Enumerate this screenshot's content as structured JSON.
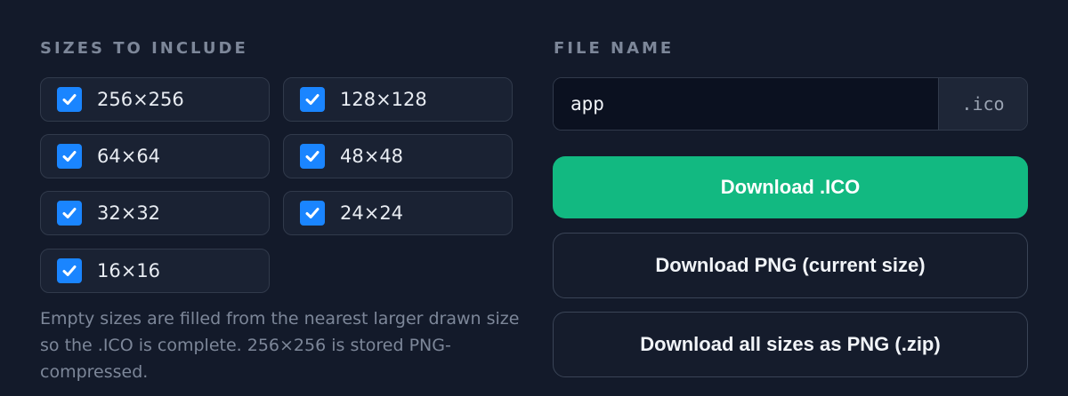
{
  "sizes_section": {
    "title": "SIZES TO INCLUDE",
    "sizes": [
      {
        "label": "256×256",
        "checked": true
      },
      {
        "label": "128×128",
        "checked": true
      },
      {
        "label": "64×64",
        "checked": true
      },
      {
        "label": "48×48",
        "checked": true
      },
      {
        "label": "32×32",
        "checked": true
      },
      {
        "label": "24×24",
        "checked": true
      },
      {
        "label": "16×16",
        "checked": true
      }
    ],
    "note": "Empty sizes are filled from the nearest larger drawn size so the .ICO is complete. 256×256 is stored PNG-compressed."
  },
  "file_section": {
    "title": "FILE NAME",
    "filename_value": "app",
    "extension": ".ico"
  },
  "actions": {
    "download_ico": "Download .ICO",
    "download_png": "Download PNG (current size)",
    "download_zip": "Download all sizes as PNG (.zip)"
  },
  "colors": {
    "background": "#131a2a",
    "checkbox": "#1a85ff",
    "primary_button": "#12b981"
  }
}
